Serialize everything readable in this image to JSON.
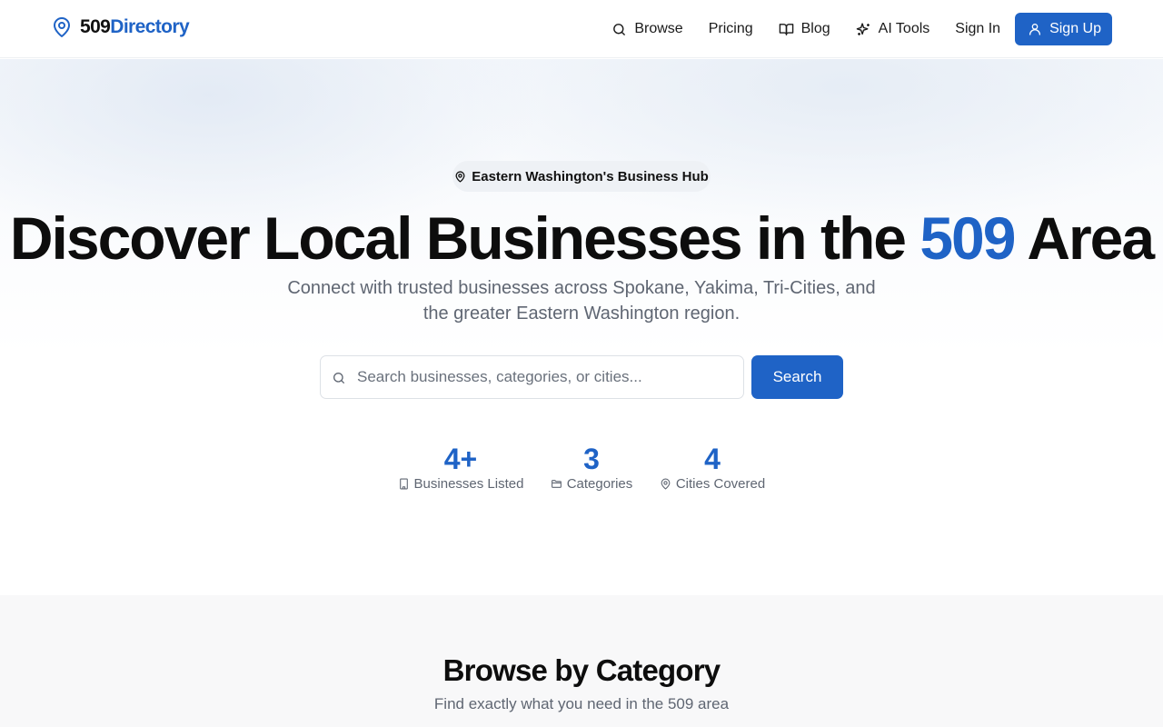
{
  "brand": {
    "name_dark": "509",
    "name_accent": "Directory",
    "accent_color": "#1f63c6"
  },
  "nav": {
    "items": [
      {
        "label": "Browse",
        "icon": "search-icon"
      },
      {
        "label": "Pricing",
        "icon": ""
      },
      {
        "label": "Blog",
        "icon": "book-open-icon"
      },
      {
        "label": "AI Tools",
        "icon": "sparkles-icon"
      },
      {
        "label": "Sign In",
        "icon": ""
      }
    ],
    "signup_label": "Sign Up",
    "signup_icon": "user-icon"
  },
  "hero": {
    "badge": "Eastern Washington's Business Hub",
    "badge_icon": "map-pin-icon",
    "title_before": "Discover Local Businesses in the ",
    "title_highlight": "509",
    "title_after": " Area",
    "subtitle": "Connect with trusted businesses across Spokane, Yakima, Tri-Cities, and the greater Eastern Washington region.",
    "search_placeholder": "Search businesses, categories, or cities...",
    "search_value": "",
    "search_button": "Search"
  },
  "stats": [
    {
      "value": "4+",
      "label": "Businesses Listed",
      "icon": "building-icon"
    },
    {
      "value": "3",
      "label": "Categories",
      "icon": "folder-icon"
    },
    {
      "value": "4",
      "label": "Cities Covered",
      "icon": "map-pin-icon"
    }
  ],
  "categories": {
    "title": "Browse by Category",
    "subtitle": "Find exactly what you need in the 509 area"
  }
}
